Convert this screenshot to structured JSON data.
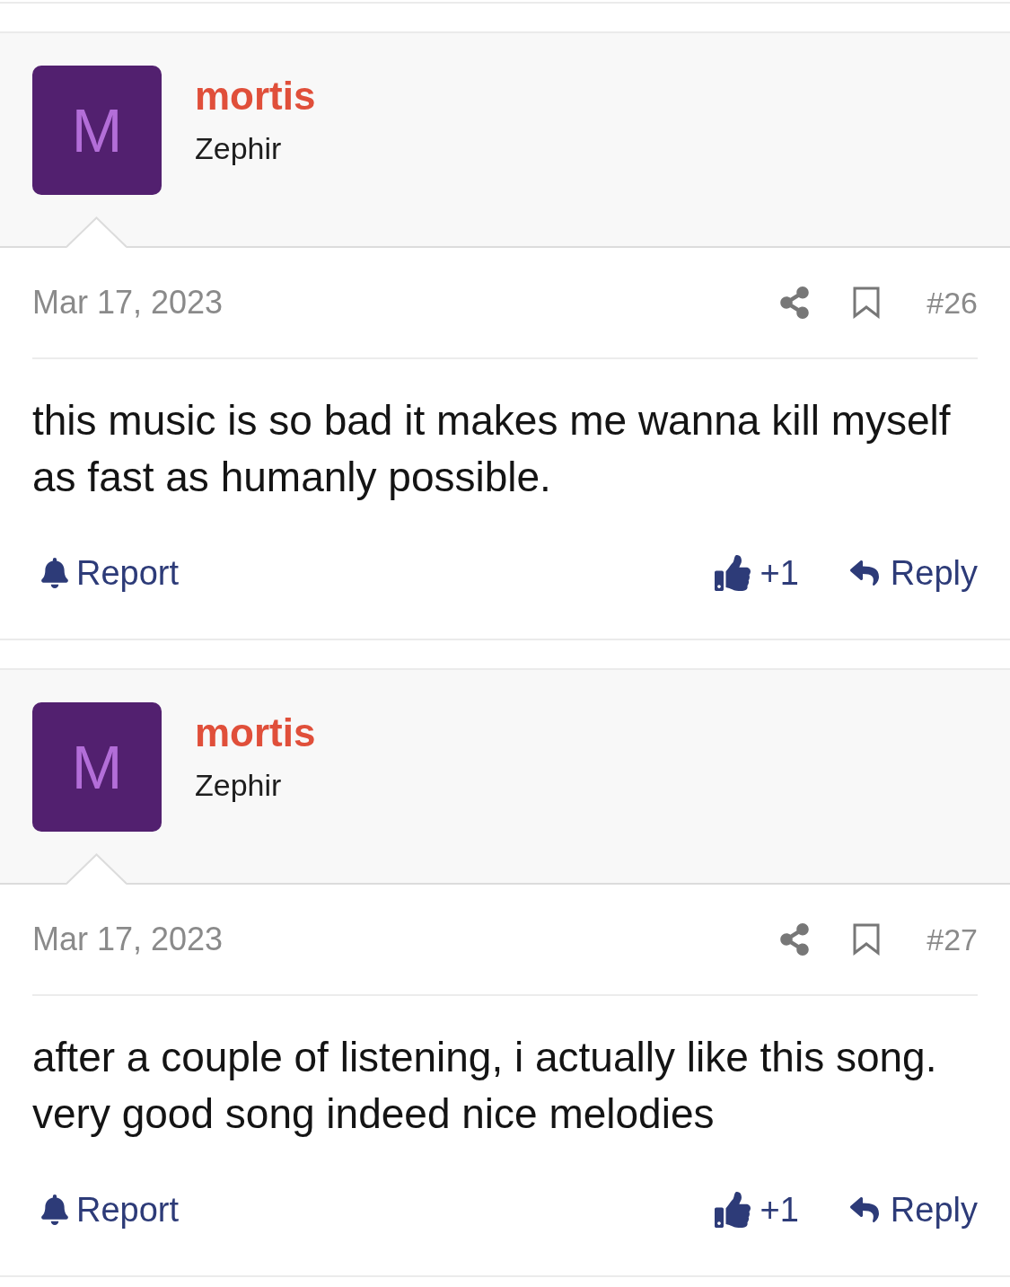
{
  "posts": [
    {
      "avatar_letter": "M",
      "username": "mortis",
      "user_title": "Zephir",
      "date": "Mar 17, 2023",
      "post_number": "#26",
      "body": "this music is so bad it makes me wanna kill myself as fast as humanly possible.",
      "actions": [
        {
          "kind": "report",
          "label": "Report"
        },
        {
          "kind": "like",
          "label": "+1"
        },
        {
          "kind": "reply",
          "label": "Reply"
        }
      ]
    },
    {
      "avatar_letter": "M",
      "username": "mortis",
      "user_title": "Zephir",
      "date": "Mar 17, 2023",
      "post_number": "#27",
      "body": "after a couple of listening, i actually like this song. very good song indeed nice melodies",
      "actions": [
        {
          "kind": "report",
          "label": "Report"
        },
        {
          "kind": "like",
          "label": "+1"
        },
        {
          "kind": "reply",
          "label": "Reply"
        }
      ]
    }
  ]
}
